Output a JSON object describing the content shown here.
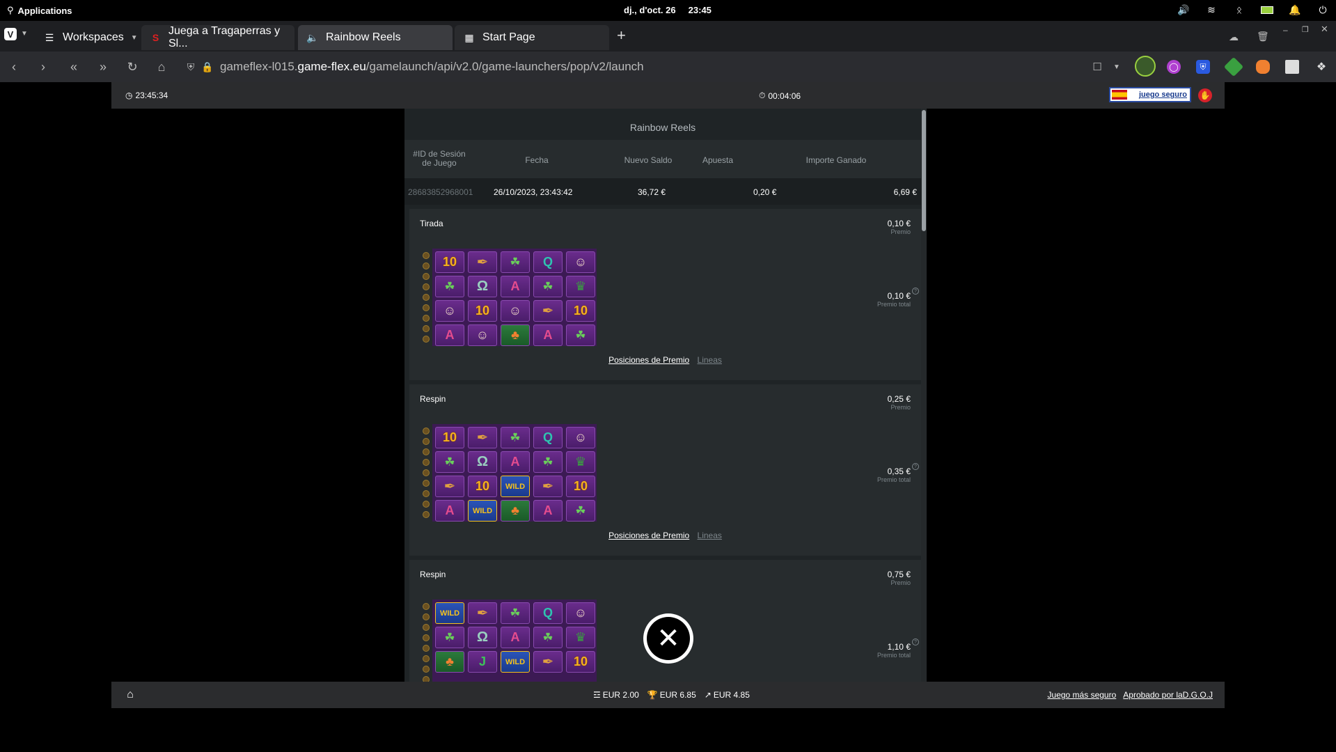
{
  "os": {
    "apps_label": "Applications",
    "clock": "dj., d'oct. 26     23:45"
  },
  "tabs": [
    {
      "label": "Workspaces"
    },
    {
      "label": "Juega a Tragaperras y Sl..."
    },
    {
      "label": "Rainbow Reels"
    },
    {
      "label": "Start Page"
    }
  ],
  "url": {
    "prefix": "gameflex-l015.",
    "host": "game-flex.eu",
    "path": "/gamelaunch/api/v2.0/game-launchers/pop/v2/launch"
  },
  "gamebar": {
    "time": "23:45:34",
    "session": "00:04:06",
    "juego_seguro": "juego seguro"
  },
  "history": {
    "title": "Rainbow Reels",
    "columns": [
      "#ID de Sesión de Juego",
      "Fecha",
      "Nuevo Saldo",
      "Apuesta",
      "Importe Ganado"
    ],
    "row": {
      "id": "28683852968001",
      "fecha": "26/10/2023, 23:43:42",
      "saldo": "36,72 €",
      "apuesta": "0,20 €",
      "ganado": "6,69 €"
    },
    "spins": [
      {
        "name": "Tirada",
        "prize": "0,10 €",
        "prize_label": "Premio",
        "total": "0,10 €",
        "total_label": "Premio total",
        "link_a": "Posiciones de Premio",
        "link_b": "Lineas"
      },
      {
        "name": "Respin",
        "prize": "0,25 €",
        "prize_label": "Premio",
        "total": "0,35 €",
        "total_label": "Premio total",
        "link_a": "Posiciones de Premio",
        "link_b": "Lineas"
      },
      {
        "name": "Respin",
        "prize": "0,75 €",
        "prize_label": "Premio",
        "total": "1,10 €",
        "total_label": "Premio total"
      }
    ],
    "grids": [
      [
        [
          "10",
          "pipe",
          "coin",
          "Q",
          "man"
        ],
        [
          "coin",
          "horse",
          "A",
          "coin",
          "hat"
        ],
        [
          "man",
          "10",
          "man",
          "pipe",
          "10"
        ],
        [
          "A",
          "man",
          "lep",
          "A",
          "coin"
        ]
      ],
      [
        [
          "10",
          "pipe",
          "coin",
          "Q",
          "man"
        ],
        [
          "coin",
          "horse",
          "A",
          "coin",
          "hat"
        ],
        [
          "pipe",
          "10",
          "WILD",
          "pipe",
          "10"
        ],
        [
          "A",
          "WILD",
          "lep",
          "A",
          "coin"
        ]
      ],
      [
        [
          "WILD",
          "pipe",
          "coin",
          "Q",
          "man"
        ],
        [
          "coin",
          "horse",
          "A",
          "coin",
          "hat"
        ],
        [
          "lep",
          "J",
          "WILD",
          "pipe",
          "10"
        ]
      ]
    ]
  },
  "footer": {
    "bet": "EUR 2.00",
    "win": "EUR 6.85",
    "net": "EUR 4.85",
    "link_safe": "Juego más seguro",
    "link_approved": "Aprobado por laD.G.O.J"
  }
}
